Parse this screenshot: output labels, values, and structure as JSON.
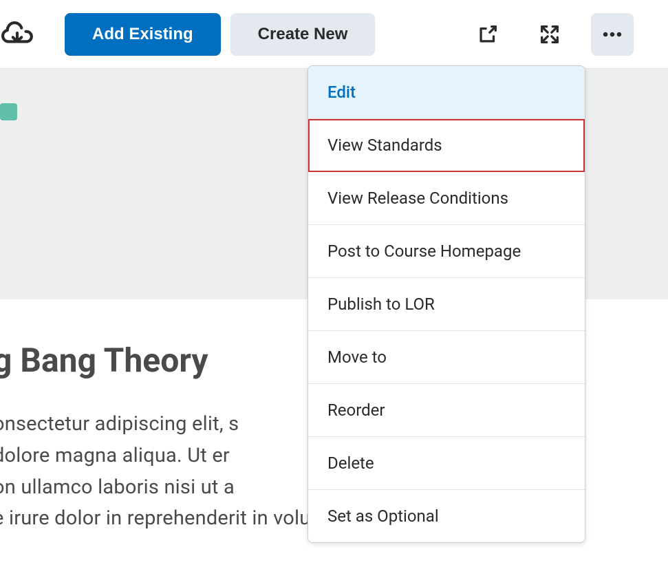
{
  "toolbar": {
    "add_existing_label": "Add Existing",
    "create_new_label": "Create New"
  },
  "dropdown": {
    "items": [
      "Edit",
      "View Standards",
      "View Release Conditions",
      "Post to Course Homepage",
      "Publish to LOR",
      "Move to",
      "Reorder",
      "Delete",
      "Set as Optional"
    ]
  },
  "content": {
    "title": "g Bang Theory",
    "body": "onsectetur adipiscing elit, s\n dolore magna aliqua. Ut er\non ullamco laboris nisi ut a\ne irure dolor in reprehenderit in voluptate"
  }
}
